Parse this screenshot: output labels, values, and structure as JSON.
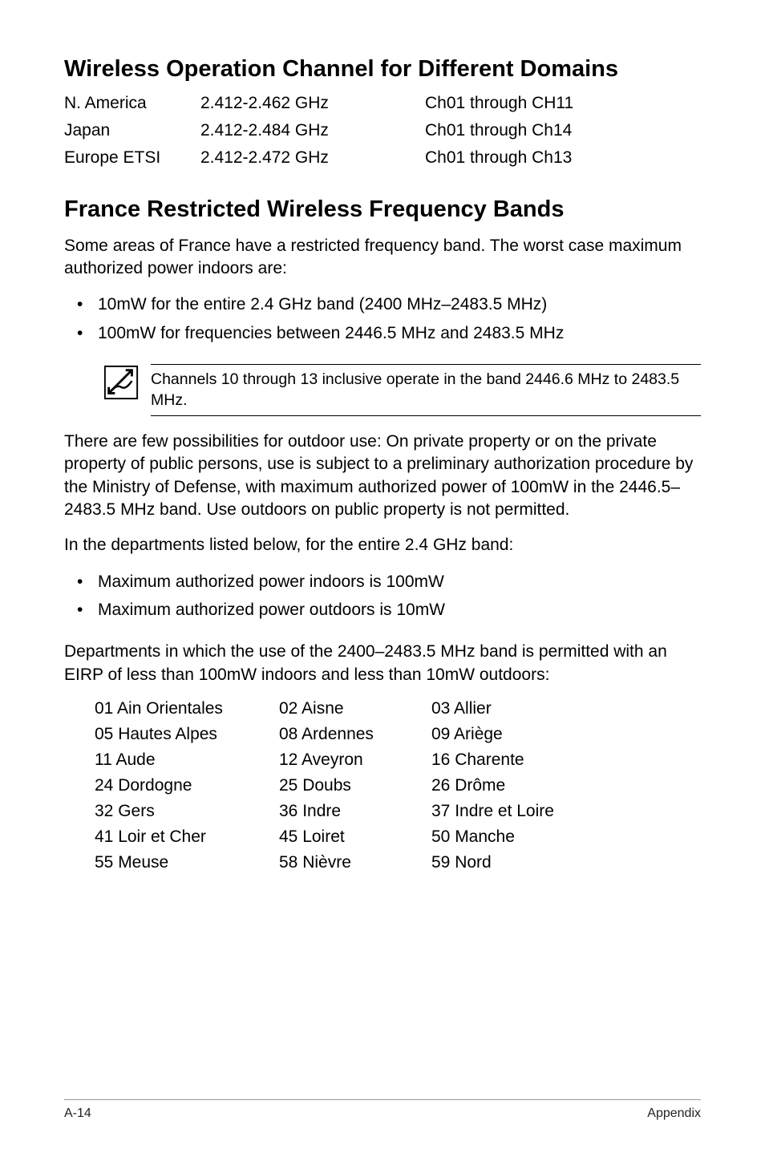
{
  "headings": {
    "h1": "Wireless Operation Channel for Different Domains",
    "h2": "France Restricted Wireless Frequency Bands"
  },
  "freq_table": [
    {
      "region": "N. America",
      "freq": "2.412-2.462 GHz",
      "ch": "Ch01 through CH11"
    },
    {
      "region": "Japan",
      "freq": "2.412-2.484 GHz",
      "ch": "Ch01 through Ch14"
    },
    {
      "region": "Europe ETSI",
      "freq": "2.412-2.472 GHz",
      "ch": "Ch01 through Ch13"
    }
  ],
  "paras": {
    "intro": "Some areas of France have a restricted frequency band. The worst case maximum authorized power indoors are:",
    "outdoor": "There are few possibilities for outdoor use: On private property or on the private property of public persons, use is subject to a preliminary authorization procedure by the Ministry of Defense, with maximum authorized power of 100mW in the 2446.5–2483.5 MHz band. Use outdoors on public property is not permitted.",
    "dept_intro": "In the departments listed below, for the entire 2.4 GHz band:",
    "dept_use": "Departments in which the use of the 2400–2483.5 MHz band is permitted with an EIRP of less than 100mW indoors and less than 10mW outdoors:"
  },
  "bullets_power": [
    "10mW for the entire 2.4 GHz band (2400 MHz–2483.5 MHz)",
    "100mW for frequencies between 2446.5 MHz and 2483.5 MHz"
  ],
  "note": "Channels 10 through 13 inclusive operate in the band 2446.6 MHz to 2483.5 MHz.",
  "bullets_max": [
    "Maximum authorized power indoors is 100mW",
    "Maximum authorized power outdoors is 10mW"
  ],
  "departments": [
    [
      "01  Ain Orientales",
      "02  Aisne",
      "03  Allier"
    ],
    [
      "05  Hautes Alpes",
      "08  Ardennes",
      "09  Ariège"
    ],
    [
      "11  Aude",
      "12  Aveyron",
      "16  Charente"
    ],
    [
      "24  Dordogne",
      "25  Doubs",
      "26  Drôme"
    ],
    [
      "32  Gers",
      "36  Indre",
      "37  Indre et Loire"
    ],
    [
      "41  Loir et Cher",
      "45  Loiret",
      "50  Manche"
    ],
    [
      "55  Meuse",
      "58  Nièvre",
      "59  Nord"
    ]
  ],
  "footer": {
    "left": "A-14",
    "right": "Appendix"
  }
}
